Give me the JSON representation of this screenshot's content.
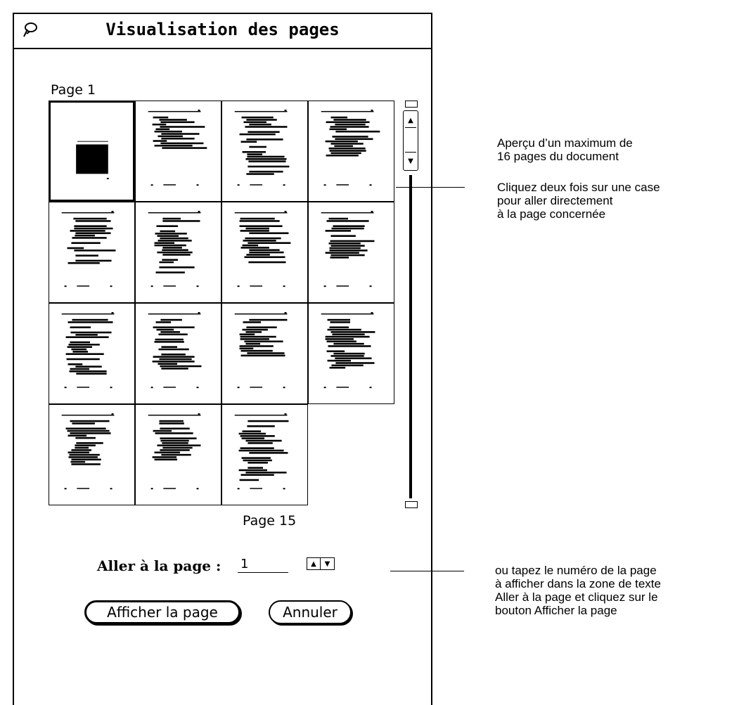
{
  "window": {
    "title": "Visualisation des pages",
    "icon": "pushpin-icon"
  },
  "thumbnails": {
    "first_label": "Page 1",
    "last_label": "Page 15",
    "count": 15,
    "selected_index": 0
  },
  "goto": {
    "label": "Aller à la page :",
    "value": "1",
    "stepper_up": "increment-arrow-icon",
    "stepper_down": "decrement-arrow-icon"
  },
  "buttons": {
    "show": "Afficher la page",
    "cancel": "Annuler"
  },
  "callouts": {
    "preview_line1": "Aperçu d’un maximum de",
    "preview_line2": "16 pages du document",
    "dblclick_line1": "Cliquez deux fois sur une case",
    "dblclick_line2": "pour aller directement",
    "dblclick_line3": "à la page concernée",
    "type_line1": "ou tapez le numéro de la page",
    "type_line2": "à afficher dans la zone de texte",
    "type_line3": "Aller à la page et cliquez sur le",
    "type_line4": "bouton Afficher la page"
  }
}
